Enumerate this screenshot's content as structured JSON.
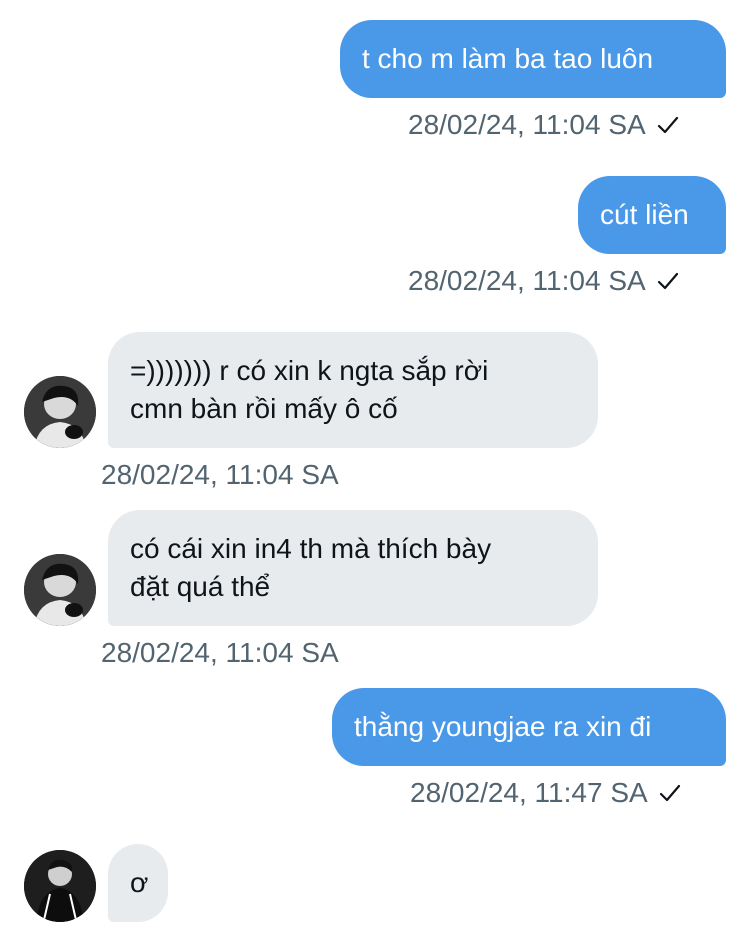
{
  "messages": [
    {
      "direction": "out",
      "text": "t cho m làm ba tao luôn",
      "time": "28/02/24, 11:04 SA"
    },
    {
      "direction": "out",
      "text": "cút liền",
      "time": "28/02/24, 11:04 SA"
    },
    {
      "direction": "in",
      "text": "=))))))) r có xin k ngta sắp rời\ncmn bàn rồi mấy ô cố",
      "time": "28/02/24, 11:04 SA"
    },
    {
      "direction": "in",
      "text": "có cái xin in4 th mà thích bày\nđặt quá thể",
      "time": "28/02/24, 11:04 SA"
    },
    {
      "direction": "out",
      "text": "thằng youngjae ra xin đi",
      "time": "28/02/24, 11:47 SA"
    },
    {
      "direction": "in",
      "text": "ơ",
      "time": ""
    }
  ],
  "icons": {
    "read_receipt": "check-icon",
    "avatar": "avatar-icon"
  },
  "colors": {
    "outgoing_bubble": "#4a99e9",
    "incoming_bubble": "#e7ebee",
    "timestamp": "#536471"
  }
}
